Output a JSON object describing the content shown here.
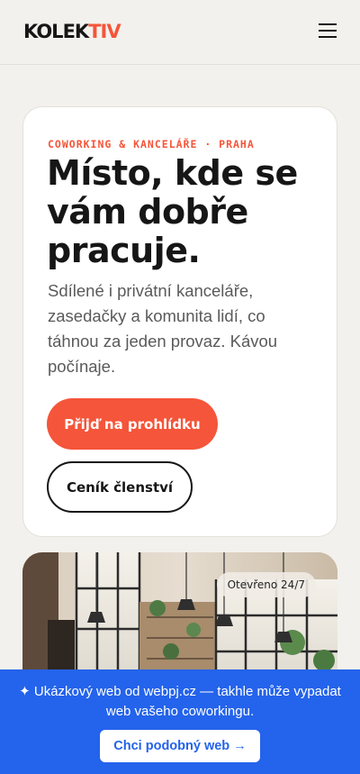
{
  "header": {
    "logo_main": "KOLEK",
    "logo_accent": "TIV",
    "menu_icon": "hamburger-menu-icon"
  },
  "hero": {
    "eyebrow": "COWORKING & KANCELÁŘE · PRAHA",
    "headline": "Místo, kde se vám dobře pracuje.",
    "lead": "Sdílené i privátní kanceláře, zasedačky a komunita lidí, co táhnou za jeden provaz. Kávou počínaje.",
    "primary_button": "Přijď na prohlídku",
    "secondary_button": "Ceník členství"
  },
  "photo": {
    "badge": "Otevřeno 24/7"
  },
  "promo": {
    "text": "✦ Ukázkový web od webpj.cz — takhle může vypadat web vašeho coworkingu.",
    "button": "Chci podobný web →"
  },
  "colors": {
    "accent": "#f5553a",
    "background": "#f3f1ed",
    "promo_blue": "#2463eb",
    "text_dark": "#161616"
  }
}
